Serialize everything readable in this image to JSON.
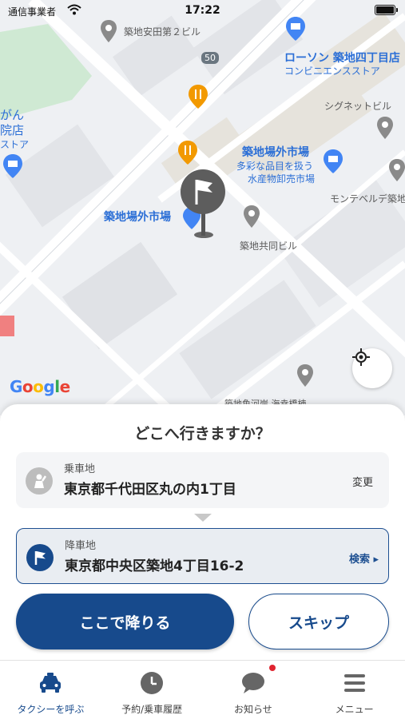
{
  "status_bar": {
    "carrier": "通信事業者",
    "time": "17:22"
  },
  "map": {
    "labels": {
      "yasuda": "築地安田第２ビル",
      "road_50": "50",
      "lawson": "ローソン 築地四丁目店",
      "lawson_sub": "コンビニエンスストア",
      "signet": "シグネットビル",
      "gan": "がん",
      "in_ten": "院店",
      "store": "ストア",
      "jogai_market": "築地場外市場",
      "jogai_sub1": "多彩な品目を扱う",
      "jogai_sub2": "水産物卸売市場",
      "monteverde": "モンテベルデ築地",
      "jogai_market_left": "築地場外市場",
      "kyodo": "築地共同ビル",
      "bottom_road": "築地魚河岸 海幸橋棟"
    },
    "google_letters": [
      "G",
      "o",
      "o",
      "g",
      "l",
      "e"
    ]
  },
  "sheet": {
    "title": "どこへ行きますか？",
    "pickup": {
      "label": "乗車地",
      "value": "東京都千代田区丸の内1丁目",
      "action": "変更"
    },
    "dropoff": {
      "label": "降車地",
      "value": "東京都中央区築地4丁目16-2",
      "action": "検索 ▸"
    },
    "primary_button": "ここで降りる",
    "secondary_button": "スキップ"
  },
  "tabs": [
    {
      "label": "タクシーを呼ぶ",
      "icon": "taxi-icon"
    },
    {
      "label": "予約/乗車履歴",
      "icon": "clock-icon"
    },
    {
      "label": "お知らせ",
      "icon": "chat-bubble-icon"
    },
    {
      "label": "メニュー",
      "icon": "menu-icon"
    }
  ],
  "colors": {
    "brand": "#174a8c",
    "notification": "#e0242f"
  }
}
